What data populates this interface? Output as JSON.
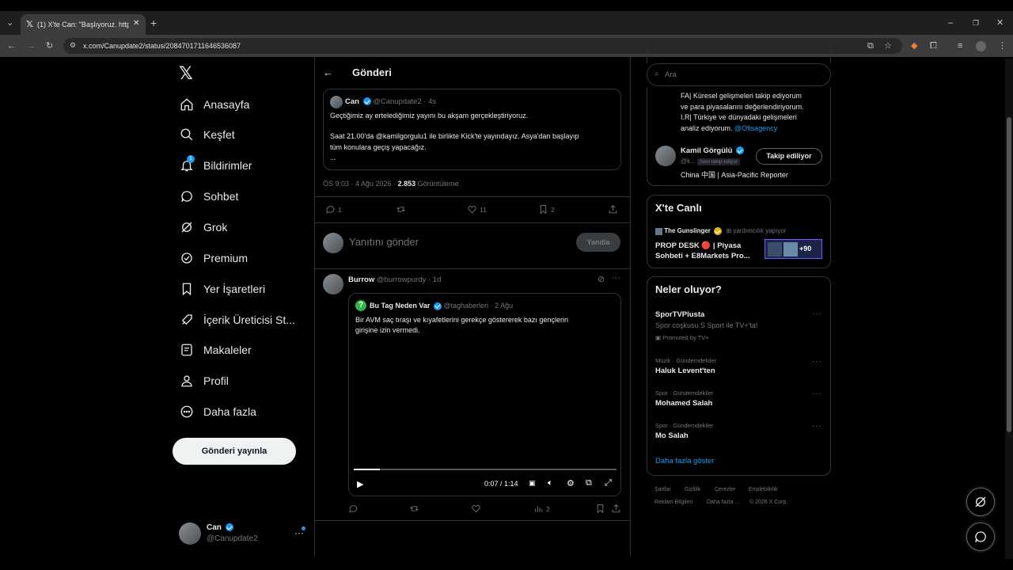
{
  "browser": {
    "tab_title": "(1) X'te Can: \"Başlıyoruz. https:/...",
    "url": "x.com/Canupdate2/status/2084701711646536087"
  },
  "sidebar": {
    "items": [
      {
        "label": "Anasayfa",
        "icon": "home-icon"
      },
      {
        "label": "Keşfet",
        "icon": "search-icon"
      },
      {
        "label": "Bildirimler",
        "icon": "bell-icon",
        "badge": "1"
      },
      {
        "label": "Sohbet",
        "icon": "chat-icon"
      },
      {
        "label": "Grok",
        "icon": "grok-icon"
      },
      {
        "label": "Premium",
        "icon": "premium-icon"
      },
      {
        "label": "Yer İşaretleri",
        "icon": "bookmark-icon"
      },
      {
        "label": "İçerik Üreticisi St...",
        "icon": "rocket-icon"
      },
      {
        "label": "Makaleler",
        "icon": "article-icon"
      },
      {
        "label": "Profil",
        "icon": "person-icon"
      },
      {
        "label": "Daha fazla",
        "icon": "more-circle-icon"
      }
    ],
    "post_button": "Gönderi yayınla",
    "account": {
      "name": "Can",
      "handle": "@Canupdate2"
    }
  },
  "main": {
    "header_title": "Gönderi",
    "quoted": {
      "name": "Can",
      "handle": "@Canupdate2",
      "time": "· 4s",
      "line1": "Geçtiğimiz ay ertelediğimiz yayını bu akşam gerçekleştiriyoruz.",
      "line2": "Saat 21.00'da @kamilgorgulu1 ile birlikte Kick'te yayındayız. Asya'dan başlayıp",
      "line3": "tüm konulara geçiş yapacağız.",
      "line4": "..."
    },
    "meta": {
      "time": "ÖS 9:03 · 4 Ağu 2026 ·",
      "views": "2.853",
      "views_label": "Görüntüleme"
    },
    "actions": {
      "replies": "1",
      "likes": "11",
      "bookmarks": "2"
    },
    "reply_placeholder": "Yanıtını gönder",
    "reply_button": "Yanıtla",
    "reply": {
      "name": "Burrow",
      "handle": "@burrowpurdy",
      "time": "· 1d",
      "quote": {
        "name": "Bu Tag Neden Var",
        "handle": "@taghaberleri",
        "time": "· 2 Ağu",
        "text1": "Bir AVM saç tıraşı ve kıyafetlerini gerekçe göstererek bazı gençlerin",
        "text2": "girişine izin vermedi."
      },
      "video": {
        "time": "0:07 / 1:14",
        "progress": 0.1
      },
      "views": "2"
    }
  },
  "right": {
    "search_placeholder": "Ara",
    "follow_card": {
      "bio1": "FA| Küresel gelişmeleri takip ediyorum",
      "bio2": "ve para piyasalarını değerlendiriyorum.",
      "bio3": "I.R| Türkiye ve dünyadaki gelişmeleri",
      "bio4": "analiz ediyorum.",
      "bio_link": "@Ofisagency",
      "user_name": "Kamil Görgülü",
      "user_handle": "@k...",
      "follows_you": "Seni takip ediyor",
      "follow_button": "Takip ediliyor",
      "user_bio": "China 中国 | Asia-Pacific Reporter"
    },
    "live": {
      "title": "X'te Canlı",
      "host": "The Gunslinger",
      "host_status": "yardımcılık yapıyor",
      "line1": "PROP DESK 🔴 | Piyasa",
      "line2": "Sohbeti + E8Markets Pro...",
      "count": "+90"
    },
    "trends": {
      "title": "Neler oluyor?",
      "items": [
        {
          "category": "",
          "title": "SporTVPlusta",
          "sub": "Spor coşkusu S Sport ile TV+'ta!",
          "promo": "Promoted by TV+"
        },
        {
          "category": "Müzik · Gündemdekiler",
          "title": "Haluk Levent'ten"
        },
        {
          "category": "Spor · Gündemdekiler",
          "title": "Mohamed Salah"
        },
        {
          "category": "Spor · Gündemdekiler",
          "title": "Mo Salah"
        }
      ],
      "show_more": "Daha fazla göster"
    },
    "footer": {
      "links1": [
        "Şartlar",
        "Gizlilik",
        "Çerezler",
        "Erişilebilirlik"
      ],
      "links2": [
        "Reklam Bilgileri",
        "Daha fazla ...",
        "© 2026 X Corp."
      ]
    }
  },
  "colors": {
    "accent": "#1d9bf0",
    "background": "#000000",
    "border": "#2f3336",
    "muted": "#71767b"
  }
}
